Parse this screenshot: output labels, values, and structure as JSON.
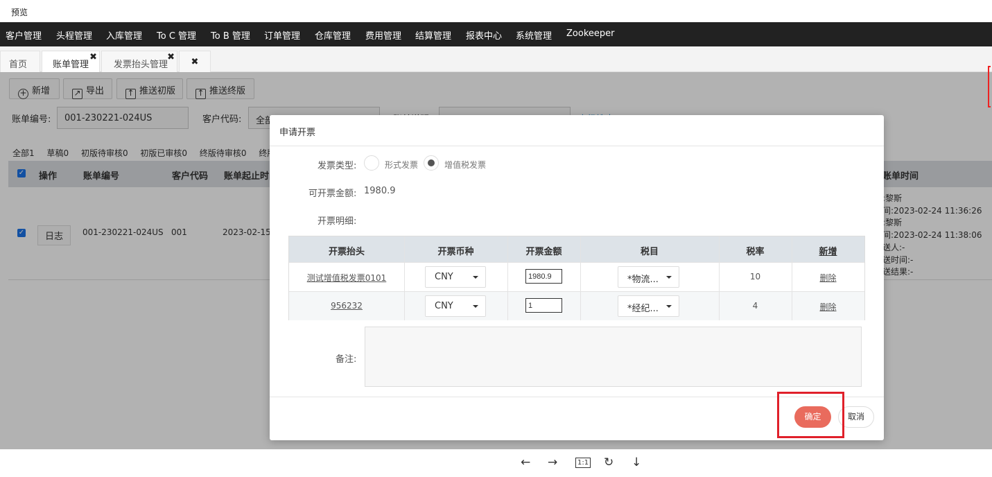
{
  "window": {
    "title": "预览"
  },
  "menu": [
    "客户管理",
    "头程管理",
    "入库管理",
    "To C 管理",
    "To B 管理",
    "订单管理",
    "仓库管理",
    "费用管理",
    "结算管理",
    "报表中心",
    "系统管理",
    "Zookeeper"
  ],
  "tabs": [
    {
      "label": "首页"
    },
    {
      "label": "账单管理"
    },
    {
      "label": "发票抬头管理"
    },
    {
      "label": ""
    }
  ],
  "toolbar": {
    "add": "新增",
    "export": "导出",
    "push_initial": "推送初版",
    "push_final": "推送终版"
  },
  "filters": {
    "bill_no_label": "账单编号:",
    "bill_no_value": "001-230221-024US",
    "customer_code_label": "客户代码:",
    "customer_code_value": "全部",
    "bill_desc_label": "账单说明",
    "advanced_search": "高级搜索"
  },
  "status_tabs": [
    "全部1",
    "草稿0",
    "初版待审核0",
    "初版已审核0",
    "终版待审核0",
    "终版已"
  ],
  "grid": {
    "headers": {
      "op": "操作",
      "bill_no": "账单编号",
      "customer": "客户代码",
      "period": "账单起止时间",
      "bill_time": "账单时间"
    },
    "row": {
      "log_btn": "日志",
      "bill_no": "001-230221-024US",
      "customer": "001",
      "period": "2023-02-15 -",
      "bill_time_lines": [
        ":黎斯",
        "间:2023-02-24 11:36:26",
        ":黎斯",
        "间:2023-02-24 11:38:06",
        "送人:-",
        "送时间:-",
        "送结果:-"
      ]
    }
  },
  "modal": {
    "title": "申请开票",
    "invoice_type_label": "发票类型:",
    "invoice_type_options": [
      "形式发票",
      "增值税发票"
    ],
    "invoice_type_selected": "增值税发票",
    "amount_label": "可开票金额:",
    "amount_value": "1980.9",
    "detail_label": "开票明细:",
    "table_headers": [
      "开票抬头",
      "开票币种",
      "开票金额",
      "税目",
      "税率",
      "新增"
    ],
    "rows": [
      {
        "title": "测试增值税发票0101",
        "currency": "CNY",
        "amount": "1980.9",
        "tax_item": "*物流...",
        "rate": "10",
        "action": "删除"
      },
      {
        "title": "956232",
        "currency": "CNY",
        "amount": "1",
        "tax_item": "*经纪...",
        "rate": "4",
        "action": "删除"
      }
    ],
    "remark_label": "备注:",
    "remark_value": "",
    "ok": "确定",
    "cancel": "取消"
  },
  "bottom_toolbar": {
    "zoom_label": "1:1"
  },
  "colors": {
    "menu_bg": "#222222",
    "ok_button": "#e96b5d",
    "highlight_frame": "#e0202a",
    "link": "#1a8ccf"
  }
}
